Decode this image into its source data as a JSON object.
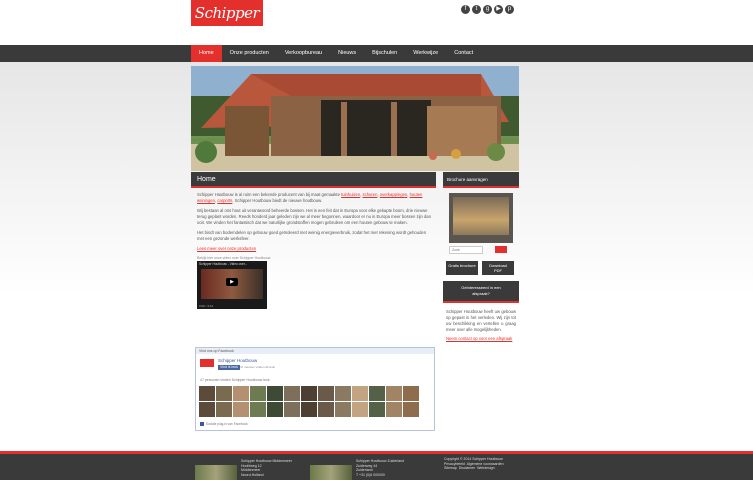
{
  "brand": {
    "logo_text": "Schipper",
    "accent": "#e3302d",
    "dark": "#3a3a3a"
  },
  "social": [
    {
      "icon": "facebook-icon",
      "glyph": "f"
    },
    {
      "icon": "twitter-icon",
      "glyph": "t"
    },
    {
      "icon": "google-plus-icon",
      "glyph": "g"
    },
    {
      "icon": "youtube-icon",
      "glyph": "▶"
    },
    {
      "icon": "pinterest-icon",
      "glyph": "p"
    }
  ],
  "nav": [
    "Home",
    "Onze producten",
    "Verkoopbureau",
    "Nieuws",
    "Bijschulen",
    "Werkwijze",
    "Contact"
  ],
  "main": {
    "title": "Home",
    "p1_lead": "Schipper Houtbouw is al ruim een bekende producent van bij maat gemaakte",
    "p1_links": [
      "tuinhuizen",
      "schuren",
      "overkappingen",
      "houten woningen",
      "carports"
    ],
    "p1_tail": "Schipper Houtbouw biedt de nieuwe houtbouw.",
    "p2": "Wij bestaan al ons hout uit verantwoord beheerde bossen. Het is een feit dat in Europa voor elke gekapte boom, drie nieuwe terug geplant worden. Reeds honderd jaar geleden zijn we al meer begonnen, waardoor er nu in Europa meer bossen zijn dan ooit. We vinden het fantastisch dat we naturlijke grondstoffen mogen gebruiken om een houten gebouw te maken.",
    "p3": "Het bindt van bodemdelen op gebouw goed geïsoleerd met weinig energieverbruik, zodat het met rekening wordt gehouden met een gezonde werksfeer.",
    "more_link": "Lees meer over onze producten",
    "video_caption": "Bekijk hier onze video over Schipper Houtbouw",
    "video_title": "Schipper Houtbouw - Video over...",
    "video_time": "0:00 / 3:12"
  },
  "facebook": {
    "header": "Vind ons op Facebook",
    "page_name": "Schipper Houtbouw",
    "like_label": "Vind ik leuk",
    "count": "47 mensen vinden dit leuk",
    "people_label": "47 personen vinden Schipper Houtbouw leuk",
    "footer": "Sociale plug-in van Facebook"
  },
  "sidebar": {
    "brochure_title": "Brochure aanvragen",
    "search_placeholder": "Zoek",
    "btn_left": "Gratis brochure",
    "btn_right_1": "Download",
    "btn_right_2": "PDF",
    "box2_line1": "Geïnteresseerd in een",
    "box2_line2": "afspraak?",
    "box2_text": "Schipper Houtbouw heeft uw gebouw op gepast in het verleden. Wij zijn tot uw beschikking en vertellen u graag meer over alle mogelijkheden.",
    "box2_link": "Neem contact op voor een afspraak"
  },
  "footer": {
    "col1": "Schipper Houtbouw Middenmeer\nHoofdweg 12\nMiddenmeer\nNoord-Holland",
    "col2": "Schipper Houtbouw Zuiderland\nZuiderweg 44\nZuiderland\nT +31 (0)6 000000",
    "col3": "Copyright © 2014 Schipper Houtbouw\nPrivacybeleid  Algemene voorwaarden\nSitemap  Disclaimer  Webdesign"
  },
  "photo_colors": [
    "#5c4a3a",
    "#8a7a62",
    "#6d7a52",
    "#a08464",
    "#4e3f33",
    "#7a6a50",
    "#c2a482",
    "#3f4a36",
    "#8f6c4e",
    "#6a5a4a",
    "#b49070",
    "#546048",
    "#7e6e5c"
  ]
}
